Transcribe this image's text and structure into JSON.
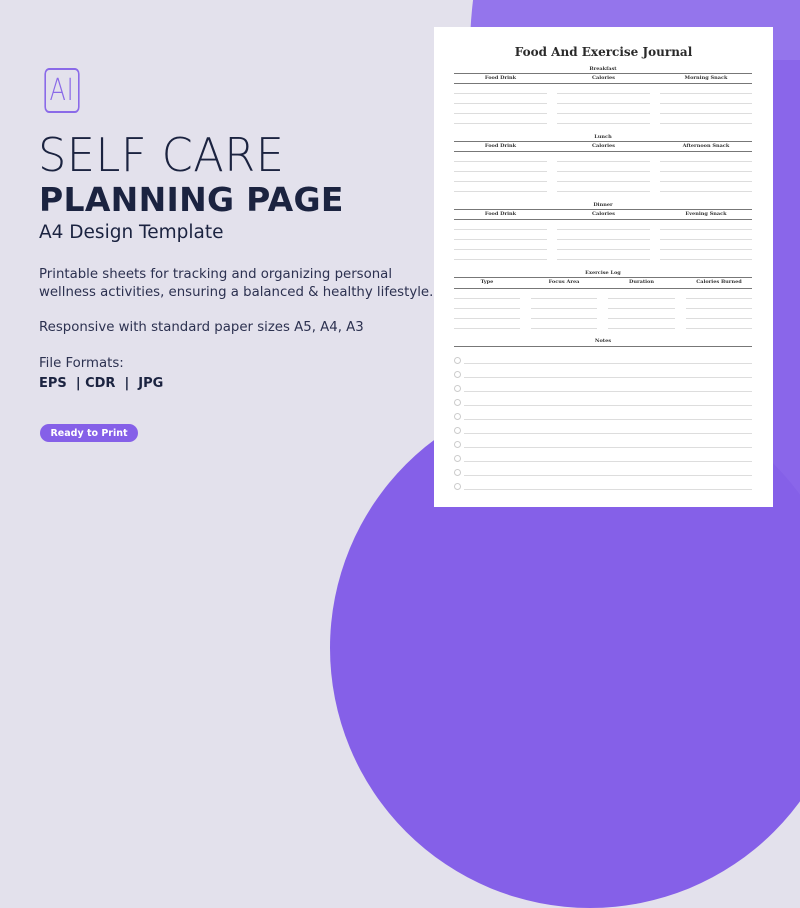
{
  "logo": {
    "text": "AI",
    "icon": "adobe-illustrator-icon"
  },
  "heading": {
    "light": "SELF CARE",
    "bold": "PLANNING PAGE",
    "subtitle": "A4 Design Template"
  },
  "description": {
    "line1": "Printable sheets for tracking and organizing personal",
    "line2": "wellness activities, ensuring a balanced & healthy lifestyle."
  },
  "sizes": "Responsive with standard paper sizes A5, A4, A3",
  "formats": {
    "label": "File Formats:",
    "values": "EPS  | CDR  |  JPG"
  },
  "button": {
    "label": "Ready to Print"
  },
  "colors": {
    "accent": "#8560e8",
    "accent_light": "#9475ec",
    "background": "#e3e1ec",
    "text": "#1b2340"
  },
  "journal": {
    "title": "Food And Exercise Journal",
    "meals": [
      {
        "title": "Breakfast",
        "columns": [
          "Food Drink",
          "Calories",
          "Morning Snack"
        ]
      },
      {
        "title": "Lunch",
        "columns": [
          "Food Drink",
          "Calories",
          "Afternoon Snack"
        ]
      },
      {
        "title": "Dinner",
        "columns": [
          "Food Drink",
          "Calories",
          "Evening Snack"
        ]
      }
    ],
    "exercise": {
      "title": "Exercise Log",
      "columns": [
        "Type",
        "Focus Area",
        "Duration",
        "Calories Burned"
      ]
    },
    "notes": {
      "title": "Notes",
      "rows": 10
    }
  }
}
